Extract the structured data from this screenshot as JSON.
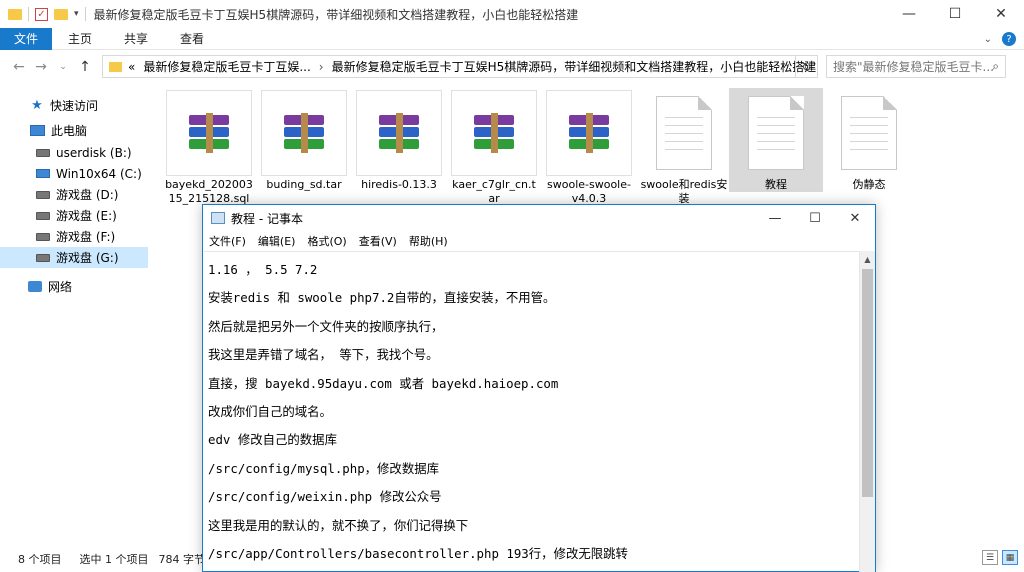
{
  "explorer": {
    "title": "最新修复稳定版毛豆卡丁互娱H5棋牌源码，带详细视频和文档搭建教程，小白也能轻松搭建",
    "ribbon": {
      "file": "文件",
      "tabs": [
        "主页",
        "共享",
        "查看"
      ]
    },
    "address": {
      "overflow": "«",
      "segment1": "最新修复稳定版毛豆卡丁互娱...",
      "segment2": "最新修复稳定版毛豆卡丁互娱H5棋牌源码，带详细视频和文档搭建教程，小白也能轻松搭建"
    },
    "search_placeholder": "搜索\"最新修复稳定版毛豆卡...",
    "sidebar": [
      {
        "label": "快速访问",
        "icon": "star-icon"
      },
      {
        "label": "此电脑",
        "icon": "computer-icon"
      },
      {
        "label": "userdisk (B:)",
        "icon": "drive-icon"
      },
      {
        "label": "Win10x64 (C:)",
        "icon": "windows-drive-icon"
      },
      {
        "label": "游戏盘 (D:)",
        "icon": "drive-icon"
      },
      {
        "label": "游戏盘 (E:)",
        "icon": "drive-icon"
      },
      {
        "label": "游戏盘 (F:)",
        "icon": "drive-icon"
      },
      {
        "label": "游戏盘 (G:)",
        "icon": "drive-icon",
        "selected": true
      },
      {
        "label": "网络",
        "icon": "network-icon"
      }
    ],
    "files": [
      {
        "name": "bayekd_20200315_215128.sql",
        "type": "archive"
      },
      {
        "name": "buding_sd.tar",
        "type": "archive"
      },
      {
        "name": "hiredis-0.13.3",
        "type": "archive"
      },
      {
        "name": "kaer_c7glr_cn.tar",
        "type": "archive"
      },
      {
        "name": "swoole-swoole-v4.0.3",
        "type": "archive"
      },
      {
        "name": "swoole和redis安装",
        "type": "text"
      },
      {
        "name": "教程",
        "type": "text",
        "selected": true
      },
      {
        "name": "伪静态",
        "type": "text"
      }
    ],
    "status": {
      "count": "8 个项目",
      "selected": "选中 1 个项目",
      "size": "784 字节"
    }
  },
  "notepad": {
    "title": "教程 - 记事本",
    "menu": [
      "文件(F)",
      "编辑(E)",
      "格式(O)",
      "查看(V)",
      "帮助(H)"
    ],
    "lines": [
      "1.16 ，  5.5   7.2",
      "安装redis 和 swoole php7.2自带的，直接安装，不用管。",
      "然后就是把另外一个文件夹的按顺序执行，",
      "我这里是弄错了域名，  等下，我找个号。",
      "直接，搜 bayekd.95dayu.com 或者 bayekd.haioep.com",
      "改成你们自己的域名。",
      "edv 修改自己的数据库",
      "/src/config/mysql.php，修改数据库",
      "/src/config/weixin.php 修改公众号",
      "这里我是用的默认的，就不换了，你们记得换下",
      "/src/app/Controllers/basecontroller.php   193行，修改无限跳转"
    ]
  }
}
